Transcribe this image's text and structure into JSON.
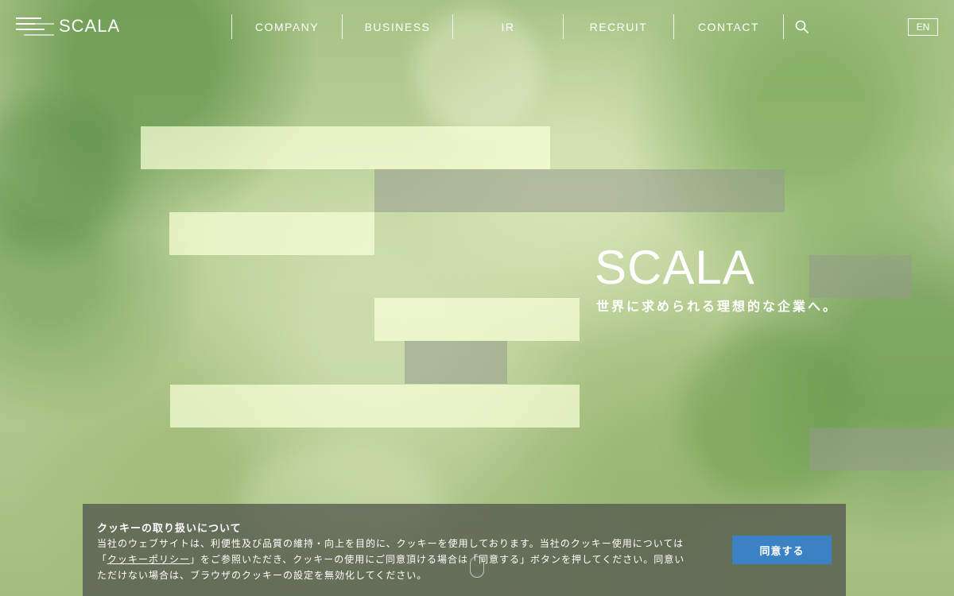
{
  "header": {
    "brand": "SCALA",
    "nav": [
      "COMPANY",
      "BUSINESS",
      "IR",
      "RECRUIT",
      "CONTACT"
    ],
    "lang": "EN",
    "icons": {
      "menu": "menu-icon",
      "search": "search-icon"
    }
  },
  "hero": {
    "title": "SCALA",
    "tagline": "世界に求められる理想的な企業へ。"
  },
  "cookie": {
    "title": "クッキーの取り扱いについて",
    "line1": "当社のウェブサイトは、利便性及び品質の維持・向上を目的に、クッキーを使用しております。当社のクッキー使用については",
    "line2_open": "「",
    "policy_link": "クッキーポリシー",
    "line2_rest": "」をご参照いただき、クッキーの使用にご同意頂ける場合は「同意する」ボタンを押してください。同意い",
    "line3": "ただけない場合は、ブラウザのクッキーの設定を無効化してください。",
    "agree": "同意する"
  },
  "colors": {
    "agree_button": "#3b82c4",
    "banner": "#55584e"
  }
}
